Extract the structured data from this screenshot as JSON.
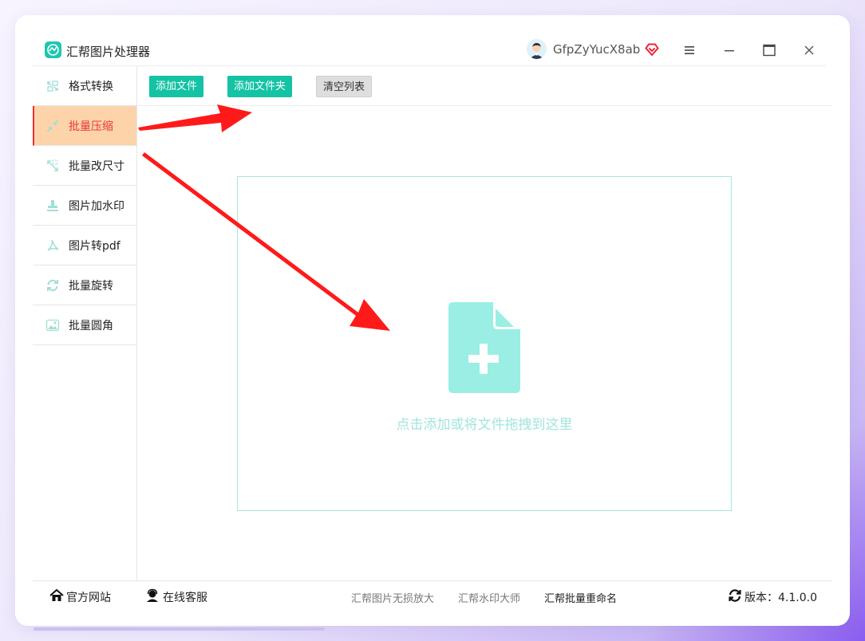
{
  "app": {
    "title": "汇帮图片处理器",
    "username": "GfpZyYucX8ab"
  },
  "window_controls": {
    "menu_icon": "hamburger-menu-icon",
    "minimize_icon": "minimize-icon",
    "maximize_icon": "maximize-icon",
    "close_icon": "close-icon"
  },
  "sidebar": {
    "items": [
      {
        "label": "格式转换",
        "icon": "format-convert-icon",
        "active": false
      },
      {
        "label": "批量压缩",
        "icon": "compress-icon",
        "active": true
      },
      {
        "label": "批量改尺寸",
        "icon": "resize-icon",
        "active": false
      },
      {
        "label": "图片加水印",
        "icon": "watermark-icon",
        "active": false
      },
      {
        "label": "图片转pdf",
        "icon": "pdf-icon",
        "active": false
      },
      {
        "label": "批量旋转",
        "icon": "rotate-icon",
        "active": false
      },
      {
        "label": "批量圆角",
        "icon": "round-corner-icon",
        "active": false
      }
    ]
  },
  "toolbar": {
    "add_file": "添加文件",
    "add_folder": "添加文件夹",
    "clear_list": "清空列表"
  },
  "dropzone": {
    "hint": "点击添加或将文件拖拽到这里",
    "icon": "add-file-icon"
  },
  "footer": {
    "website": "官方网站",
    "support": "在线客服",
    "link1": "汇帮图片无损放大",
    "link2": "汇帮水印大师",
    "link3": "汇帮批量重命名",
    "version_label": "版本：4.1.0.0"
  },
  "colors": {
    "accent_teal": "#14c2a4",
    "active_bg": "#fdd3aa",
    "active_text": "#e53935",
    "drop_border": "#a9e6df",
    "annotation_arrow": "#ff1a1a"
  }
}
